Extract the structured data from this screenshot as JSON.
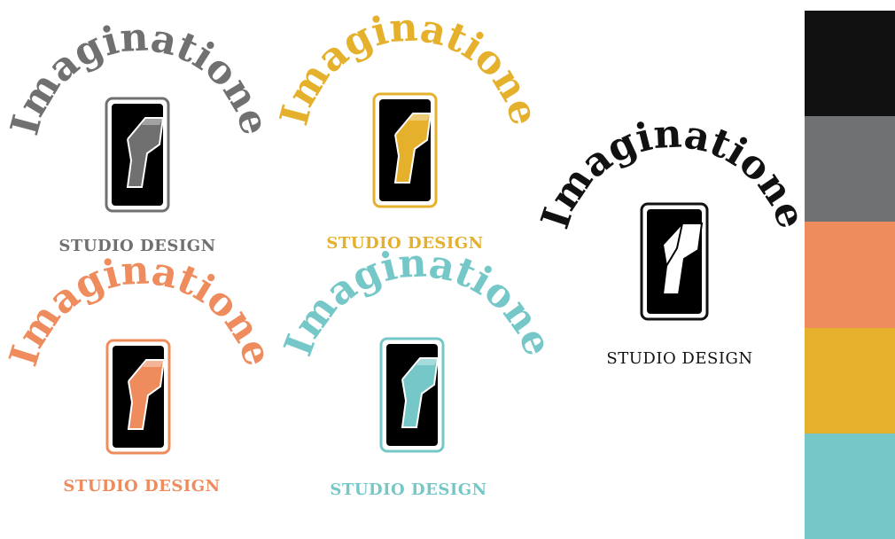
{
  "logos": [
    {
      "wordmark": "Imaginatione",
      "tagline": "STUDIO DESIGN",
      "color": "#707070"
    },
    {
      "wordmark": "Imaginatione",
      "tagline": "STUDIO DESIGN",
      "color": "#e5b02c"
    },
    {
      "wordmark": "Imaginatione",
      "tagline": "STUDIO DESIGN",
      "color": "#ee8c5e"
    },
    {
      "wordmark": "Imaginatione",
      "tagline": "STUDIO DESIGN",
      "color": "#76c8c8"
    },
    {
      "wordmark": "Imaginatione",
      "tagline": "STUDIO DESIGN",
      "color": "#111111"
    }
  ],
  "palette": [
    "#111111",
    "#707172",
    "#ee8c5e",
    "#e5b02c",
    "#76c8c8"
  ],
  "icons": {
    "logo_mark": "light-switch-icon"
  }
}
